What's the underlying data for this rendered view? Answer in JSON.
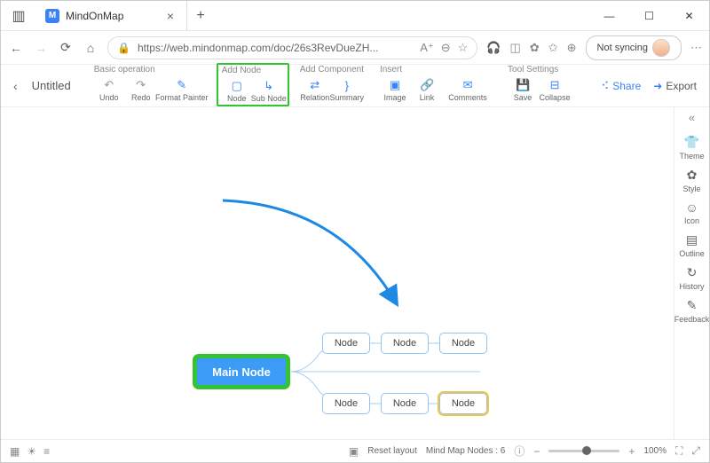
{
  "browser": {
    "tab_title": "MindOnMap",
    "url": "https://web.mindonmap.com/doc/26s3RevDueZH...",
    "sync_label": "Not syncing"
  },
  "app": {
    "doc_title": "Untitled",
    "share_label": "Share",
    "export_label": "Export",
    "groups": {
      "basic": {
        "label": "Basic operation",
        "undo": "Undo",
        "redo": "Redo",
        "fmt": "Format Painter"
      },
      "addnode": {
        "label": "Add Node",
        "node": "Node",
        "subnode": "Sub Node"
      },
      "addcomp": {
        "label": "Add Component",
        "relation": "Relation",
        "summary": "Summary"
      },
      "insert": {
        "label": "Insert",
        "image": "Image",
        "link": "Link",
        "comments": "Comments"
      },
      "tool": {
        "label": "Tool Settings",
        "save": "Save",
        "collapse": "Collapse"
      }
    }
  },
  "sidepanel": {
    "theme": "Theme",
    "style": "Style",
    "icon": "Icon",
    "outline": "Outline",
    "history": "History",
    "feedback": "Feedback"
  },
  "mindmap": {
    "main": "Main Node",
    "nodes": [
      "Node",
      "Node",
      "Node",
      "Node",
      "Node",
      "Node"
    ]
  },
  "status": {
    "reset": "Reset layout",
    "count_label": "Mind Map Nodes : 6",
    "zoom": "100%"
  }
}
